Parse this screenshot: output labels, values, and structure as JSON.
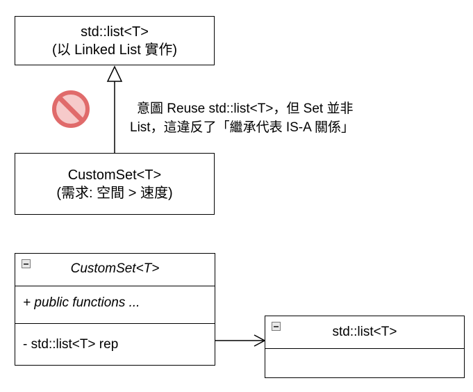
{
  "diagram": {
    "base_class": {
      "name": "std::list<T>",
      "note": "(以 Linked List 實作)"
    },
    "derived_class": {
      "name": "CustomSet<T>",
      "note": "(需求: 空間 > 速度)"
    },
    "inheritance_annotation": {
      "line1": "意圖 Reuse std::list<T>，但 Set 並非",
      "line2": "List，這違反了「繼承代表 IS-A 關係」"
    },
    "composition": {
      "class": {
        "name": "CustomSet<T>",
        "operations": "+ public functions ...",
        "attributes": "- std::list<T> rep"
      },
      "member_class": {
        "name": "std::list<T>"
      }
    },
    "colors": {
      "prohibited_icon": "#e06b6b",
      "prohibited_fill": "#f6caca"
    },
    "icons": {
      "prohibited": "prohibited-icon",
      "collapse": "collapse-icon"
    }
  }
}
